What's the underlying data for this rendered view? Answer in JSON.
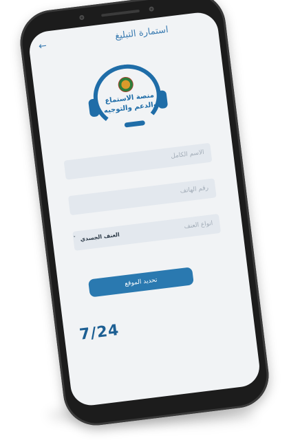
{
  "header": {
    "title": "استمارة التبليغ",
    "back_icon": "arrow-left-icon"
  },
  "logo": {
    "line1": "منصة الاستماع",
    "line2": "والدعم والتوجيه",
    "icon": "headset-icon"
  },
  "form": {
    "full_name_placeholder": "الاسم الكامل",
    "phone_placeholder": "رقم الهاتف",
    "violence_type_placeholder": "انواع العنف",
    "violence_type_value": "العنف الجسدي"
  },
  "actions": {
    "locate_button_label": "تحديد الموقع"
  },
  "badge": {
    "text": "7/24"
  },
  "colors": {
    "accent": "#2a79b0",
    "background": "#f1f3f5",
    "field": "#e3e8ee"
  }
}
